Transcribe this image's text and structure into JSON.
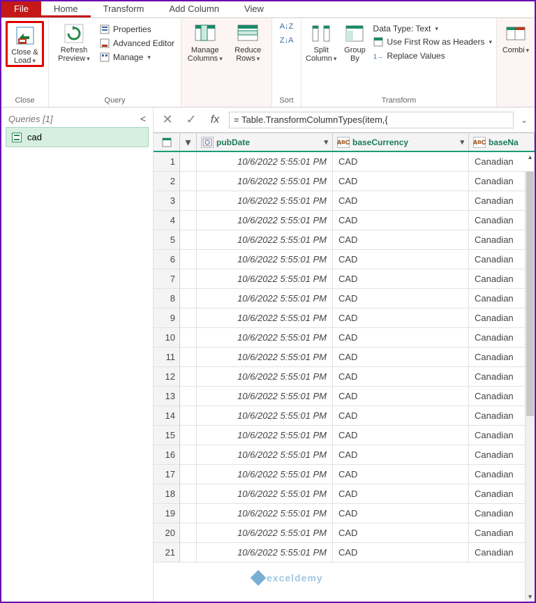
{
  "tabs": {
    "file": "File",
    "home": "Home",
    "transform": "Transform",
    "addcol": "Add Column",
    "view": "View"
  },
  "ribbon": {
    "close": {
      "label": "Close &\nLoad",
      "group": "Close"
    },
    "refresh": {
      "label": "Refresh\nPreview",
      "group": "Query"
    },
    "props": "Properties",
    "adv": "Advanced Editor",
    "manage": "Manage",
    "managecols": {
      "label": "Manage\nColumns"
    },
    "reducerows": {
      "label": "Reduce\nRows"
    },
    "sort": "Sort",
    "split": {
      "label": "Split\nColumn"
    },
    "groupby": {
      "label": "Group\nBy"
    },
    "datatype": "Data Type: Text",
    "firstrow": "Use First Row as Headers",
    "replace": "Replace Values",
    "transform": "Transform",
    "combine": {
      "label": "Combi"
    }
  },
  "queries": {
    "header": "Queries [1]",
    "item": "cad"
  },
  "formula": "= Table.TransformColumnTypes(item,{",
  "columns": {
    "pubDate": "pubDate",
    "baseCurrency": "baseCurrency",
    "baseName": "baseNa"
  },
  "row": {
    "date": "10/6/2022 5:55:01 PM",
    "currency": "CAD",
    "name": "Canadian"
  },
  "rowcount": 21,
  "watermark": "exceldemy"
}
